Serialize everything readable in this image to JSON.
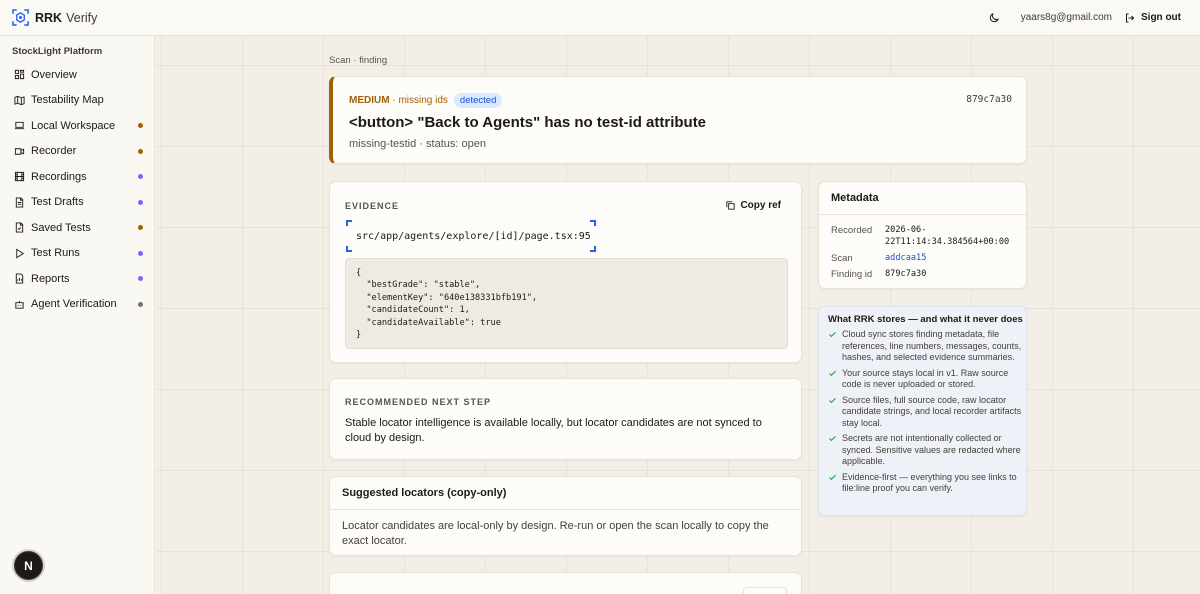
{
  "header": {
    "brand_name": "RRK",
    "brand_sub": "Verify",
    "email": "yaars8g@gmail.com",
    "signout_label": "Sign out"
  },
  "sidebar": {
    "title": "StockLight Platform",
    "items": [
      {
        "label": "Overview",
        "icon": "grid-icon",
        "dot": ""
      },
      {
        "label": "Testability Map",
        "icon": "map-icon",
        "dot": ""
      },
      {
        "label": "Local Workspace",
        "icon": "laptop-icon",
        "dot": "#a16207"
      },
      {
        "label": "Recorder",
        "icon": "video-icon",
        "dot": "#a16207"
      },
      {
        "label": "Recordings",
        "icon": "film-icon",
        "dot": "#8b5cf6"
      },
      {
        "label": "Test Drafts",
        "icon": "file-icon",
        "dot": "#8b5cf6"
      },
      {
        "label": "Saved Tests",
        "icon": "file-check-icon",
        "dot": "#a16207"
      },
      {
        "label": "Test Runs",
        "icon": "play-icon",
        "dot": "#8b5cf6"
      },
      {
        "label": "Reports",
        "icon": "report-icon",
        "dot": "#8b5cf6"
      },
      {
        "label": "Agent Verification",
        "icon": "bot-icon",
        "dot": "#78716c"
      }
    ]
  },
  "breadcrumb": {
    "scan": "Scan",
    "separator": "·",
    "finding": "finding"
  },
  "finding": {
    "severity": "MEDIUM",
    "category": "· missing ids",
    "badge": "detected",
    "id": "879c7a30",
    "title": "<button> \"Back to Agents\" has no test-id attribute",
    "subtitle": "missing-testid · status: open",
    "accent_color": "#a16207"
  },
  "evidence": {
    "label": "EVIDENCE",
    "copy_label": "Copy ref",
    "path": "src/app/agents/explore/[id]/page.tsx:95",
    "code": "{\n  \"bestGrade\": \"stable\",\n  \"elementKey\": \"640e138331bfb191\",\n  \"candidateCount\": 1,\n  \"candidateAvailable\": true\n}"
  },
  "recommended": {
    "label": "RECOMMENDED NEXT STEP",
    "text": "Stable locator intelligence is available locally, but locator candidates are not synced to cloud by design."
  },
  "suggested": {
    "title": "Suggested locators (copy-only)",
    "text": "Locator candidates are local-only by design. Re-run or open the scan locally to copy the exact locator."
  },
  "metadata": {
    "title": "Metadata",
    "recorded_label": "Recorded",
    "recorded_value": "2026-06-22T11:14:34.384564+00:00",
    "scan_label": "Scan",
    "scan_value": "addcaa15",
    "finding_label": "Finding id",
    "finding_value": "879c7a30"
  },
  "stores": {
    "title": "What RRK stores — and what it never does",
    "items": [
      "Cloud sync stores finding metadata, file references, line numbers, messages, counts, hashes, and selected evidence summaries.",
      "Your source stays local in v1. Raw source code is never uploaded or stored.",
      "Source files, full source code, raw locator candidate strings, and local recorder artifacts stay local.",
      "Secrets are not intentionally collected or synced. Sensitive values are redacted where applicable.",
      "Evidence-first — everything you see links to file:line proof you can verify."
    ]
  },
  "fab": {
    "label": "N"
  }
}
